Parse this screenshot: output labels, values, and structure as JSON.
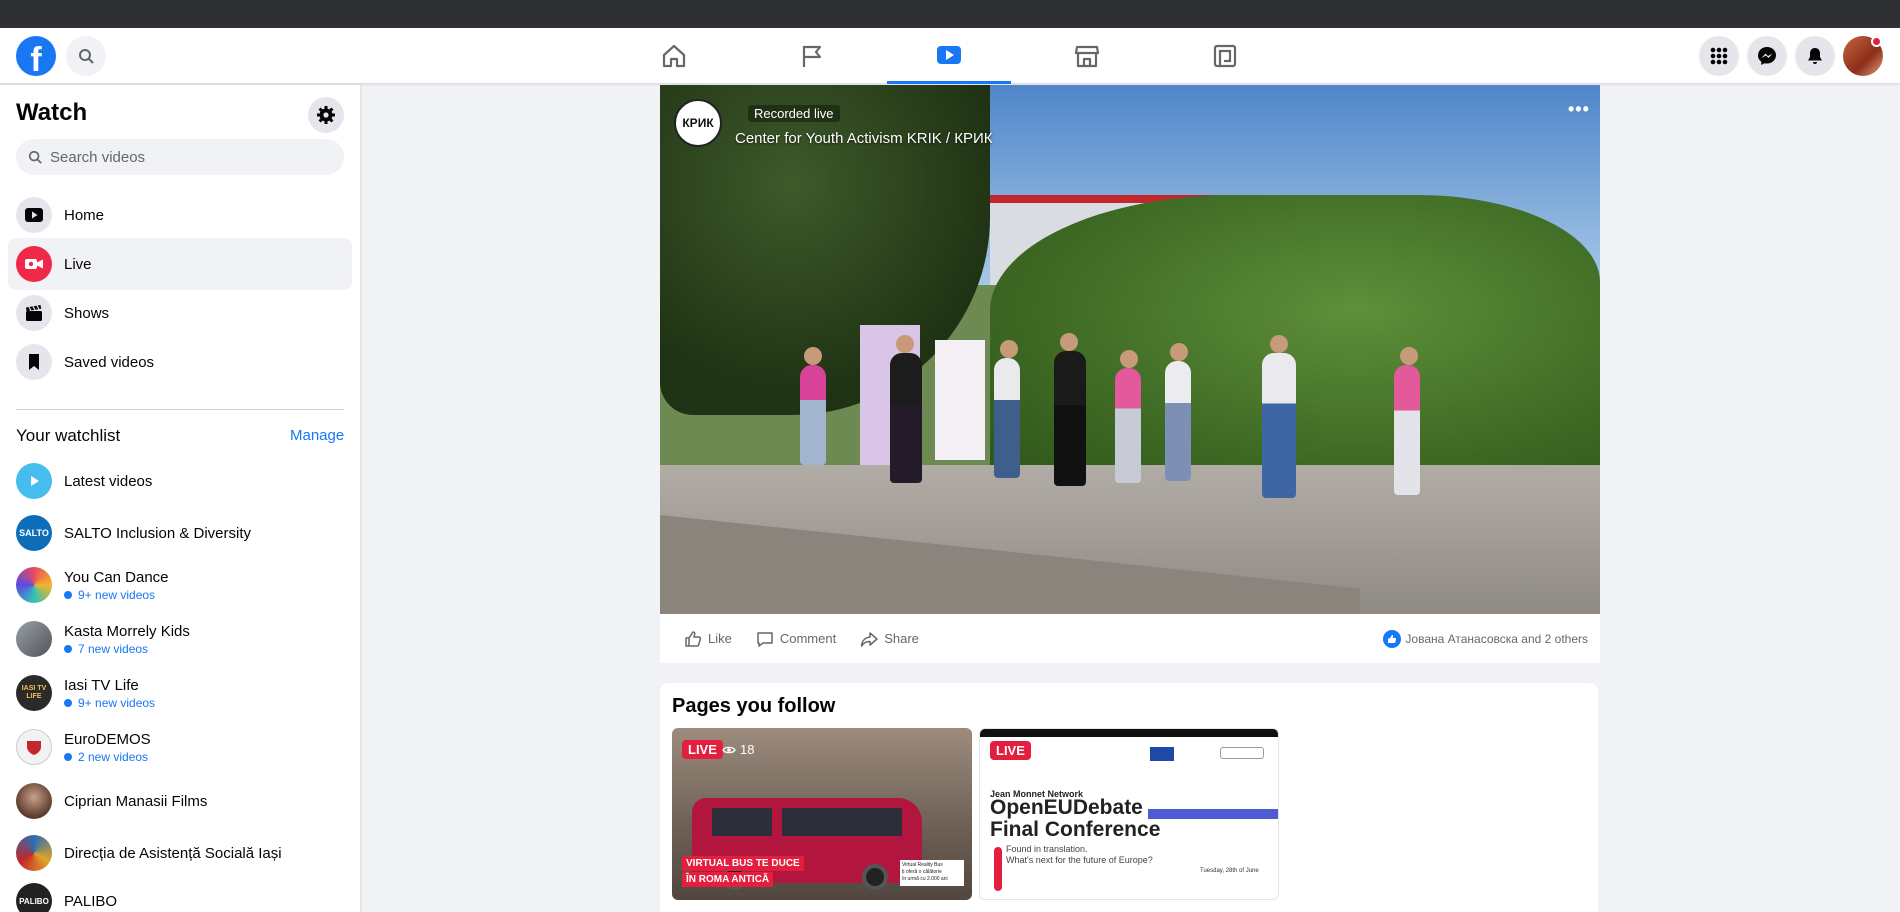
{
  "topbar": {
    "logo_letter": "f",
    "nav_tabs": [
      "home",
      "pages",
      "watch",
      "marketplace",
      "gaming"
    ]
  },
  "sidebar": {
    "title": "Watch",
    "search_placeholder": "Search videos",
    "menu": [
      {
        "label": "Home",
        "icon": "play-icon"
      },
      {
        "label": "Live",
        "icon": "live-camera-icon"
      },
      {
        "label": "Shows",
        "icon": "clapperboard-icon"
      },
      {
        "label": "Saved videos",
        "icon": "bookmark-icon"
      }
    ],
    "watchlist_title": "Your watchlist",
    "manage_label": "Manage",
    "watchlist": [
      {
        "name": "Latest videos",
        "sub": ""
      },
      {
        "name": "SALTO Inclusion & Diversity",
        "sub": "",
        "avatar_text": "SALTO"
      },
      {
        "name": "You Can Dance",
        "sub": "9+ new videos"
      },
      {
        "name": "Kasta Morrely Kids",
        "sub": "7 new videos"
      },
      {
        "name": "Iasi TV Life",
        "sub": "9+ new videos",
        "avatar_text": "IASI TV LIFE"
      },
      {
        "name": "EuroDEMOS",
        "sub": "2 new videos"
      },
      {
        "name": "Ciprian Manasii Films",
        "sub": ""
      },
      {
        "name": "Direcția de Asistență Socială Iași",
        "sub": ""
      },
      {
        "name": "PALIBO",
        "sub": "",
        "avatar_text": "PALIBO"
      }
    ]
  },
  "video": {
    "avatar_text": "КРИК",
    "status": "Recorded live",
    "channel": "Center for Youth Activism KRIK / КРИК",
    "actions": {
      "like": "Like",
      "comment": "Comment",
      "share": "Share"
    },
    "reactions_text": "Јована Атанасовска and 2 others"
  },
  "pages_you_follow": {
    "title": "Pages you follow",
    "thumbs": [
      {
        "badge": "LIVE",
        "viewers": "18",
        "caption1": "VIRTUAL BUS TE DUCE",
        "caption2": "ÎN ROMA ANTICĂ",
        "side_note": "Virtual Reality Bus\nți oferă o călătorie\nîn urmă cu 2.000 ani"
      },
      {
        "badge": "LIVE",
        "kicker": "Jean Monnet Network",
        "title_line1": "OpenEUDebate",
        "title_line2": "Final Conference",
        "sub1": "Found in translation.",
        "sub2": "What's next for the future of Europe?",
        "date": "Tuesday, 28th of June"
      }
    ]
  },
  "colors": {
    "accent": "#1877f2",
    "live": "#e41e3f",
    "background": "#f0f2f5"
  }
}
